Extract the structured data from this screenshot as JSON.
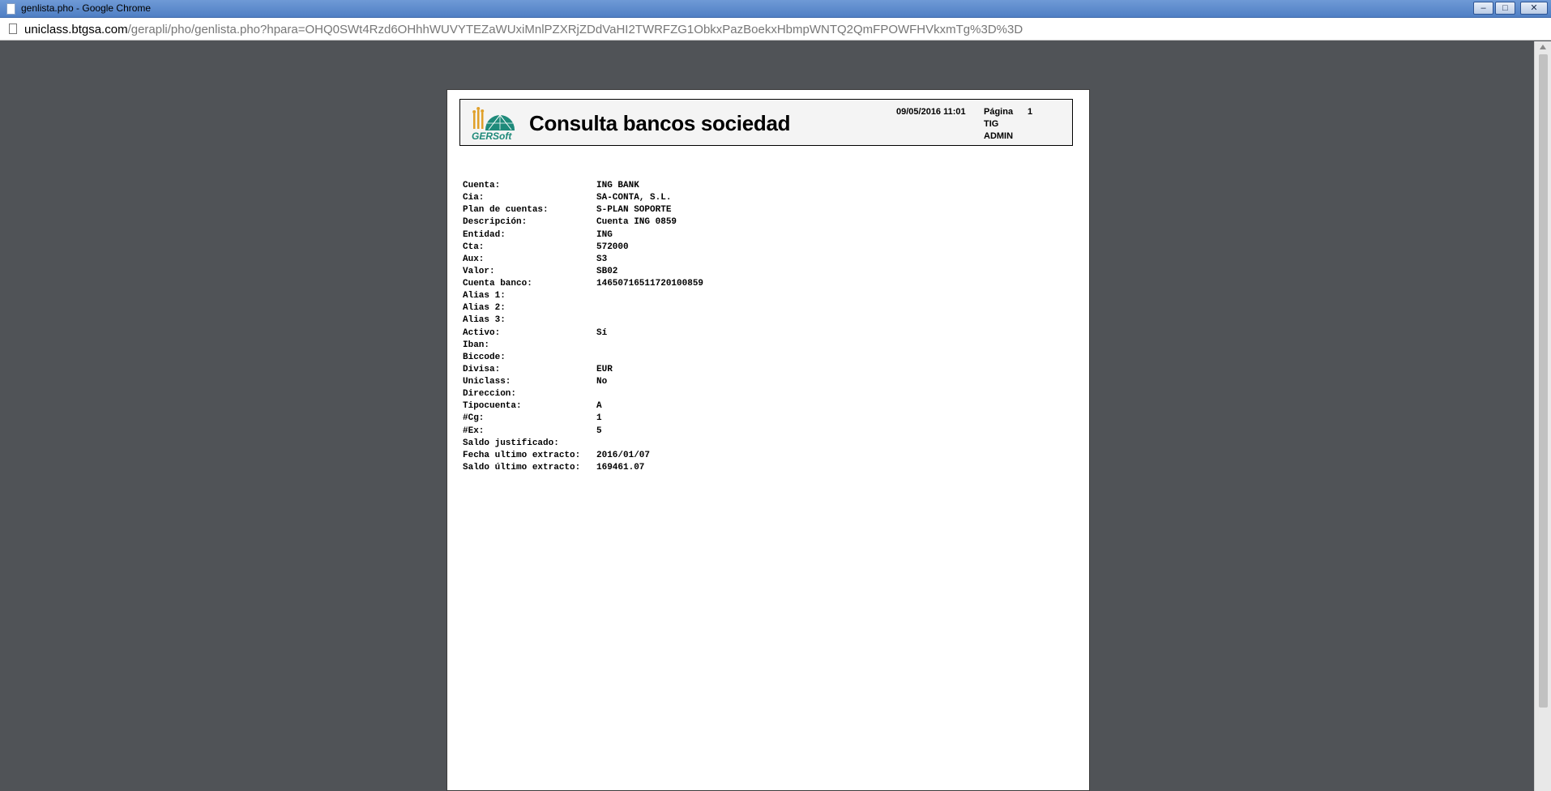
{
  "window": {
    "title": "genlista.pho - Google Chrome",
    "minimize_glyph": "–",
    "maximize_glyph": "□",
    "close_glyph": "✕"
  },
  "address": {
    "domain": "uniclass.btgsa.com",
    "path": "/gerapli/pho/genlista.pho?hpara=OHQ0SWt4Rzd6OHhhWUVYTEZaWUxiMnlPZXRjZDdVaHI2TWRFZG1ObkxPazBoekxHbmpWNTQ2QmFPOWFHVkxmTg%3D%3D"
  },
  "report": {
    "logo_text": "GERSoft",
    "title": "Consulta bancos sociedad",
    "date": "09/05/2016 11:01",
    "page_label": "Página",
    "page_number": "1",
    "company": "TIG",
    "user": "ADMIN",
    "fields": [
      {
        "label": "Cuenta:",
        "value": "ING BANK"
      },
      {
        "label": "Cia:",
        "value": "SA-CONTA, S.L."
      },
      {
        "label": "Plan de cuentas:",
        "value": "S-PLAN SOPORTE"
      },
      {
        "label": "Descripción:",
        "value": "Cuenta ING 0859"
      },
      {
        "label": "Entidad:",
        "value": "ING"
      },
      {
        "label": "Cta:",
        "value": "572000"
      },
      {
        "label": "Aux:",
        "value": "S3"
      },
      {
        "label": "Valor:",
        "value": "SB02"
      },
      {
        "label": "Cuenta banco:",
        "value": "14650716511720100859"
      },
      {
        "label": "Alias 1:",
        "value": ""
      },
      {
        "label": "Alias 2:",
        "value": ""
      },
      {
        "label": "Alias 3:",
        "value": ""
      },
      {
        "label": "Activo:",
        "value": "Sí"
      },
      {
        "label": "Iban:",
        "value": ""
      },
      {
        "label": "Biccode:",
        "value": ""
      },
      {
        "label": "Divisa:",
        "value": "EUR"
      },
      {
        "label": "Uniclass:",
        "value": "No"
      },
      {
        "label": "Direccion:",
        "value": ""
      },
      {
        "label": "Tipocuenta:",
        "value": "A"
      },
      {
        "label": "#Cg:",
        "value": "1"
      },
      {
        "label": "#Ex:",
        "value": "5"
      },
      {
        "label": "Saldo justificado:",
        "value": ""
      },
      {
        "label": "Fecha ultimo extracto:",
        "value": "2016/01/07"
      },
      {
        "label": "Saldo último extracto:",
        "value": "169461.07"
      }
    ]
  },
  "colors": {
    "viewer_background": "#505357",
    "logo_green": "#1e8a7a",
    "logo_orange": "#e0a02a"
  }
}
